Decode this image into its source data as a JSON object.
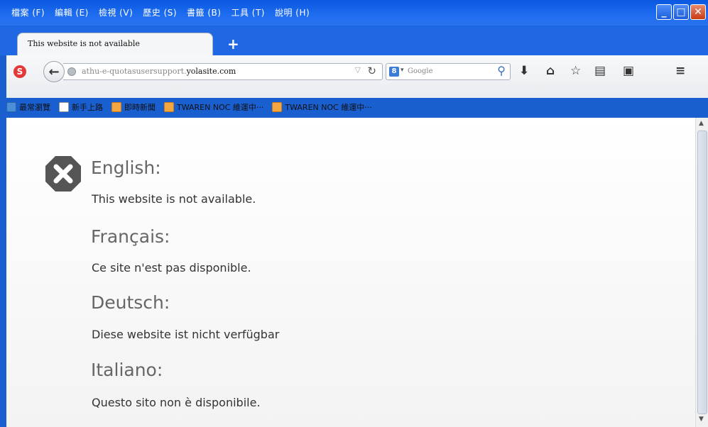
{
  "menu": [
    "檔案 (F)",
    "編輯 (E)",
    "檢視 (V)",
    "歷史 (S)",
    "書籤 (B)",
    "工具 (T)",
    "說明 (H)"
  ],
  "window": {
    "minimize": "_",
    "maximize": "□",
    "close": "✕"
  },
  "tab": {
    "title": "This website is not available",
    "new_tab": "+"
  },
  "navbar": {
    "url_prefix": "athu-e-quotasusersupport.",
    "url_domain": "yolasite.com",
    "search_placeholder": "Google",
    "search_engine_letter": "8"
  },
  "bookmarks": [
    {
      "label": "最常瀏覽",
      "icon": "most-visited-icon"
    },
    {
      "label": "新手上路",
      "icon": "page-icon"
    },
    {
      "label": "即時新聞",
      "icon": "rss-icon"
    },
    {
      "label": "TWAREN NOC 維運中···",
      "icon": "rss-icon"
    },
    {
      "label": "TWAREN NOC 維運中···",
      "icon": "rss-icon"
    }
  ],
  "content": {
    "languages": [
      {
        "heading": "English:",
        "text": "This website is not available."
      },
      {
        "heading": "Français:",
        "text": "Ce site n'est pas disponible."
      },
      {
        "heading": "Deutsch:",
        "text": "Diese website ist nicht verfügbar"
      },
      {
        "heading": "Italiano:",
        "text": "Questo sito non è disponibile."
      }
    ]
  },
  "colors": {
    "chrome_blue": "#1f67e3",
    "close_red": "#c93a14",
    "heading_gray": "#666666"
  }
}
